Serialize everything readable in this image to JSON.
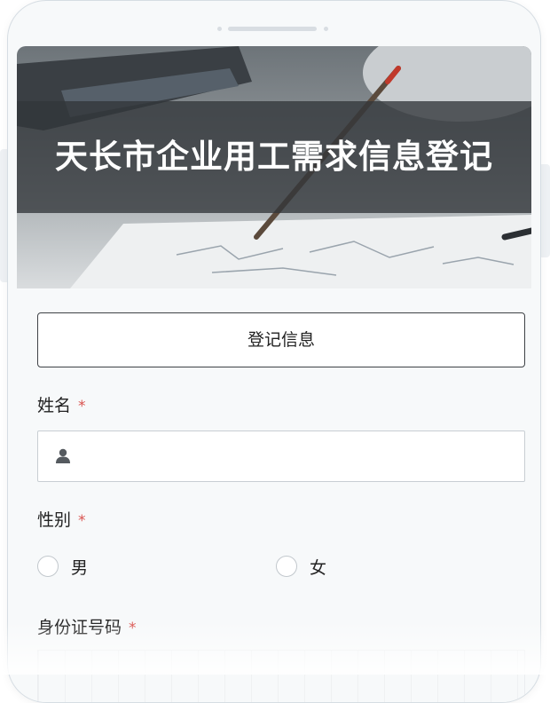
{
  "banner": {
    "title": "天长市企业用工需求信息登记"
  },
  "form": {
    "section_button": "登记信息",
    "name": {
      "label": "姓名",
      "required_mark": "*",
      "value": "",
      "icon": "user-icon"
    },
    "gender": {
      "label": "性别",
      "required_mark": "*",
      "options": [
        "男",
        "女"
      ],
      "selected": null
    },
    "id_number": {
      "label": "身份证号码",
      "required_mark": "*"
    }
  },
  "colors": {
    "required": "#d9534f",
    "text": "#222222",
    "border": "#c8ced3"
  }
}
